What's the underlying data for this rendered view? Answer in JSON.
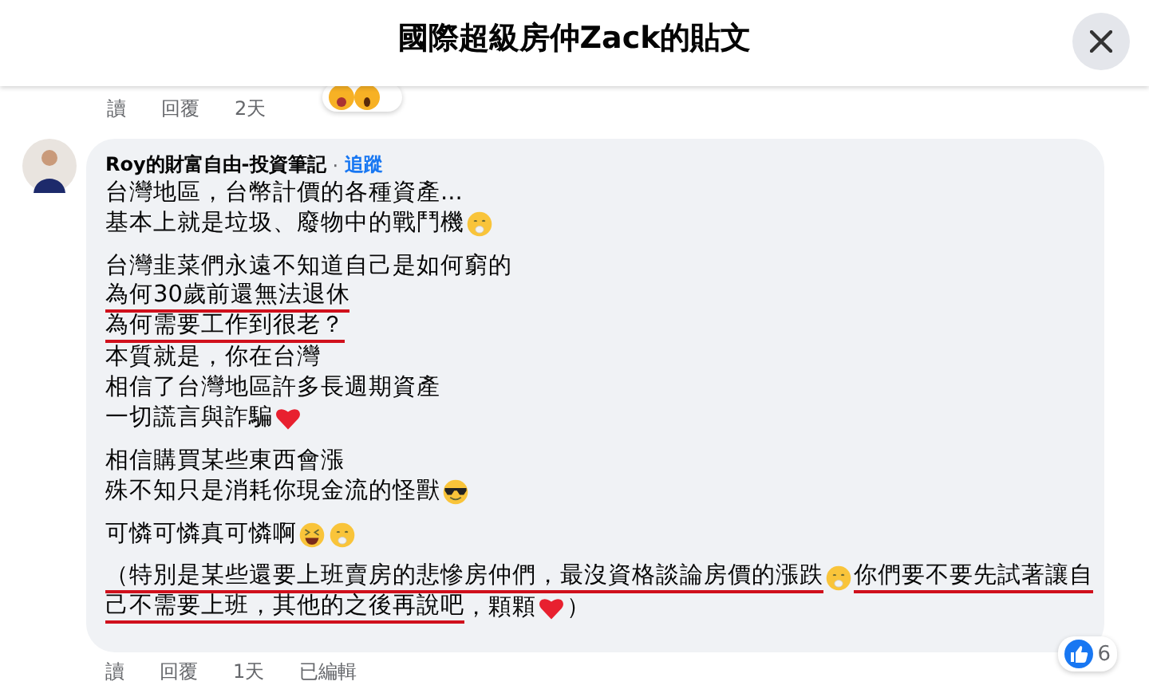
{
  "dialog": {
    "title": "國際超級房仲Zack的貼文"
  },
  "previous_comment": {
    "actions": [
      "讀",
      "回覆",
      "2天"
    ]
  },
  "comment": {
    "author": "Roy的財富自由-投資筆記",
    "separator": "·",
    "follow": "追蹤",
    "paragraphs": [
      [
        {
          "parts": [
            {
              "kind": "text",
              "text": "台灣地區，台幣計價的各種資產...",
              "underlined": false
            }
          ]
        },
        {
          "parts": [
            {
              "kind": "text",
              "text": "基本上就是垃圾、廢物中的戰鬥機",
              "underlined": false
            },
            {
              "kind": "shush"
            }
          ]
        }
      ],
      [
        {
          "parts": [
            {
              "kind": "text",
              "text": "台灣韭菜們永遠不知道自己是如何窮的",
              "underlined": false
            }
          ]
        },
        {
          "parts": [
            {
              "kind": "text",
              "text": "為何30歲前還無法退休",
              "underlined": true
            }
          ]
        },
        {
          "parts": [
            {
              "kind": "text",
              "text": "為何需要工作到很老？",
              "underlined": true
            }
          ]
        },
        {
          "parts": [
            {
              "kind": "text",
              "text": "本質就是，你在台灣",
              "underlined": false
            }
          ]
        },
        {
          "parts": [
            {
              "kind": "text",
              "text": "相信了台灣地區許多長週期資產",
              "underlined": false
            }
          ]
        },
        {
          "parts": [
            {
              "kind": "text",
              "text": "一切謊言與詐騙",
              "underlined": false
            },
            {
              "kind": "heart"
            }
          ]
        }
      ],
      [
        {
          "parts": [
            {
              "kind": "text",
              "text": "相信購買某些東西會漲",
              "underlined": false
            }
          ]
        },
        {
          "parts": [
            {
              "kind": "text",
              "text": "殊不知只是消耗你現金流的怪獸",
              "underlined": false
            },
            {
              "kind": "cool"
            }
          ]
        }
      ],
      [
        {
          "parts": [
            {
              "kind": "text",
              "text": "可憐可憐真可憐啊",
              "underlined": false
            },
            {
              "kind": "laugh"
            },
            {
              "kind": "shush"
            }
          ]
        }
      ],
      [
        {
          "parts": [
            {
              "kind": "text",
              "text": "（特別是某些還要上班賣房的悲慘房仲們，最沒資格談論房價的漲跌",
              "underlined": true
            },
            {
              "kind": "shush"
            },
            {
              "kind": "text",
              "text": "你們要不要先試著讓自",
              "underlined": true
            }
          ]
        },
        {
          "parts": [
            {
              "kind": "text",
              "text": "己不需要上班，其他的之後再說吧",
              "underlined": true
            },
            {
              "kind": "text",
              "text": "，顆顆",
              "underlined": false
            },
            {
              "kind": "heart"
            },
            {
              "kind": "text",
              "text": "）",
              "underlined": false
            }
          ]
        }
      ]
    ],
    "like_count": "6",
    "actions": [
      "讀",
      "回覆",
      "1天",
      "已編輯"
    ]
  }
}
